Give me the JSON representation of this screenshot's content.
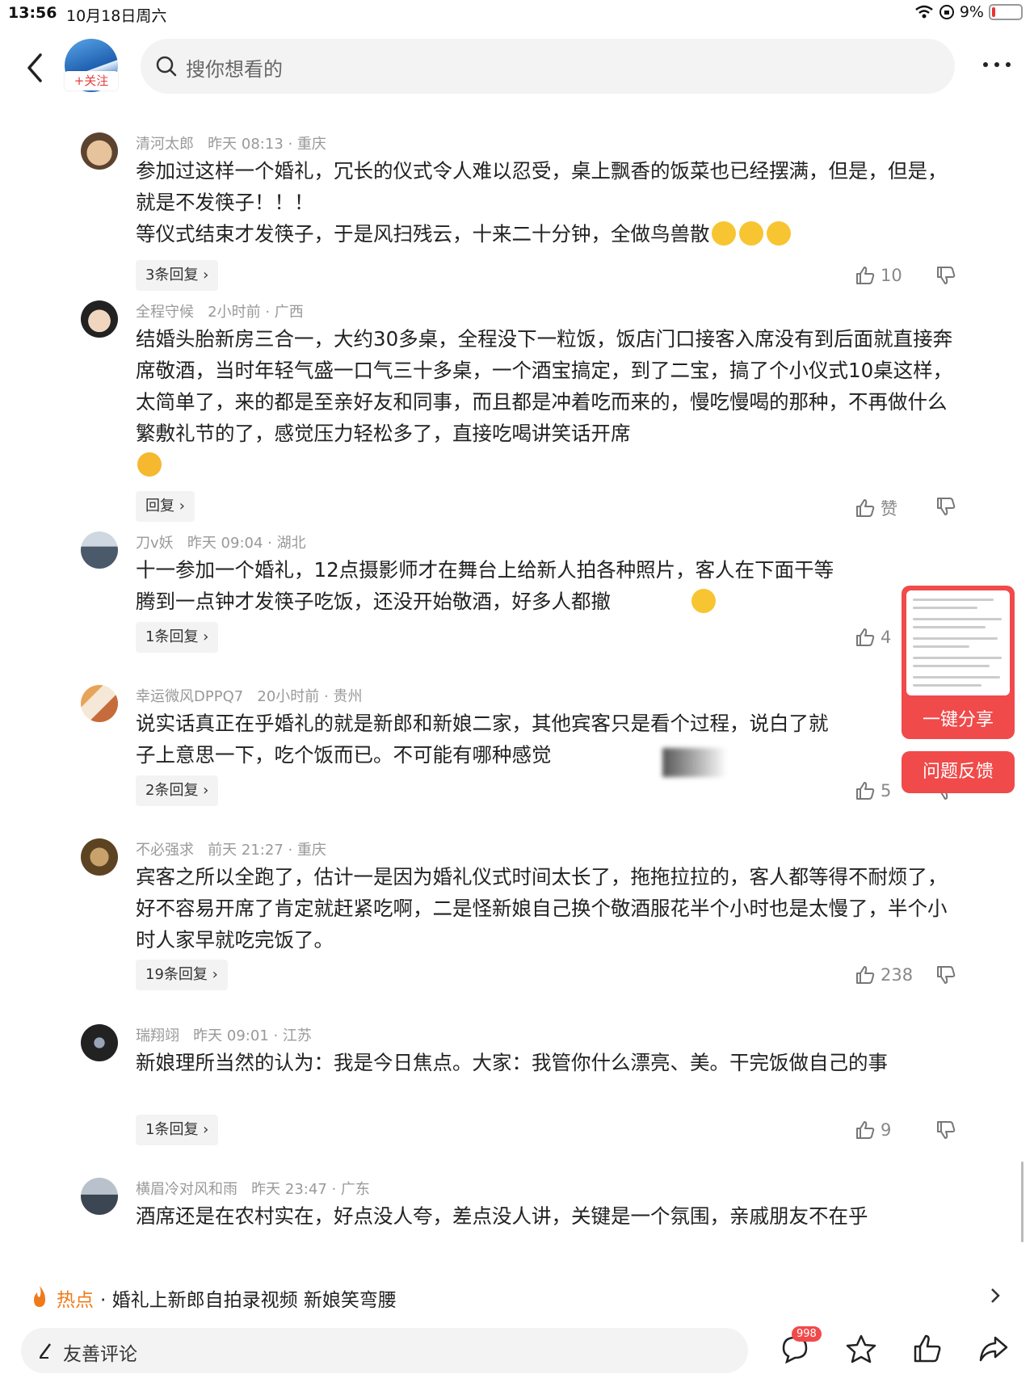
{
  "status": {
    "time": "13:56",
    "date": "10月18日周六",
    "battery": "9%"
  },
  "header": {
    "follow_label": "+关注",
    "search_placeholder": "搜你想看的"
  },
  "comments": [
    {
      "user": "清河太郎",
      "meta": "昨天 08:13 · 重庆",
      "text": "参加过这样一个婚礼，冗长的仪式令人难以忍受，桌上飘香的饭菜也已经摆满，但是，但是，就是不发筷子！！！\n等仪式结束才发筷子，于是风扫残云，十来二十分钟，全做鸟兽散",
      "reply": "3条回复",
      "likes": "10"
    },
    {
      "user": "全程守候",
      "meta": "2小时前 · 广西",
      "text": "结婚头胎新房三合一，大约30多桌，全程没下一粒饭，饭店门口接客入席没有到后面就直接奔席敬酒，当时年轻气盛一口气三十多桌，一个酒宝搞定，到了二宝，搞了个小仪式10桌这样，太简单了，来的都是至亲好友和同事，而且都是冲着吃而来的，慢吃慢喝的那种，不再做什么繁敷礼节的了，感觉压力轻松多了，直接吃喝讲笑话开席",
      "reply": "回复",
      "likes": "赞"
    },
    {
      "user": "刀v妖",
      "meta": "昨天 09:04 · 湖北",
      "text": "十一参加一个婚礼，12点摄影师才在舞台上给新人拍各种照片，客人在下面干等\n腾到一点钟才发筷子吃饭，还没开始敬酒，好多人都撤",
      "reply": "1条回复",
      "likes": "4"
    },
    {
      "user": "幸运微风DPPQ7",
      "meta": "20小时前 · 贵州",
      "text": "说实话真正在乎婚礼的就是新郎和新娘二家，其他宾客只是看个过程，说白了就\n子上意思一下，吃个饭而已。不可能有哪种感觉",
      "reply": "2条回复",
      "likes": "5"
    },
    {
      "user": "不必强求",
      "meta": "前天 21:27 · 重庆",
      "text": "宾客之所以全跑了，估计一是因为婚礼仪式时间太长了，拖拖拉拉的，客人都等得不耐烦了，好不容易开席了肯定就赶紧吃啊，二是怪新娘自己换个敬酒服花半个小时也是太慢了，半个小时人家早就吃完饭了。",
      "reply": "19条回复",
      "likes": "238"
    },
    {
      "user": "瑞翔翊",
      "meta": "昨天 09:01 · 江苏",
      "text": "新娘理所当然的认为：我是今日焦点。大家：我管你什么漂亮、美。干完饭做自己的事",
      "reply": "1条回复",
      "likes": "9"
    },
    {
      "user": "横眉冷对风和雨",
      "meta": "昨天 23:47 · 广东",
      "text": "酒席还是在农村实在，好点没人夸，差点没人讲，关键是一个氛围，亲戚朋友不在乎",
      "reply": "",
      "likes": ""
    }
  ],
  "floating": {
    "share_label": "一键分享",
    "feedback_label": "问题反馈"
  },
  "hot": {
    "label": "热点",
    "title": "· 婚礼上新郎自拍录视频 新娘笑弯腰"
  },
  "bottom": {
    "comment_placeholder": "友善评论",
    "comment_count": "998"
  },
  "colors": {
    "accent": "#f04a4a",
    "hot": "#f07a1a",
    "muted": "#999999"
  },
  "icons": [
    "back-icon",
    "search-icon",
    "more-icon",
    "thumb-up-icon",
    "thumb-down-icon",
    "chevron-right-icon",
    "fire-icon",
    "pen-icon",
    "comment-icon",
    "star-icon",
    "share-icon"
  ]
}
